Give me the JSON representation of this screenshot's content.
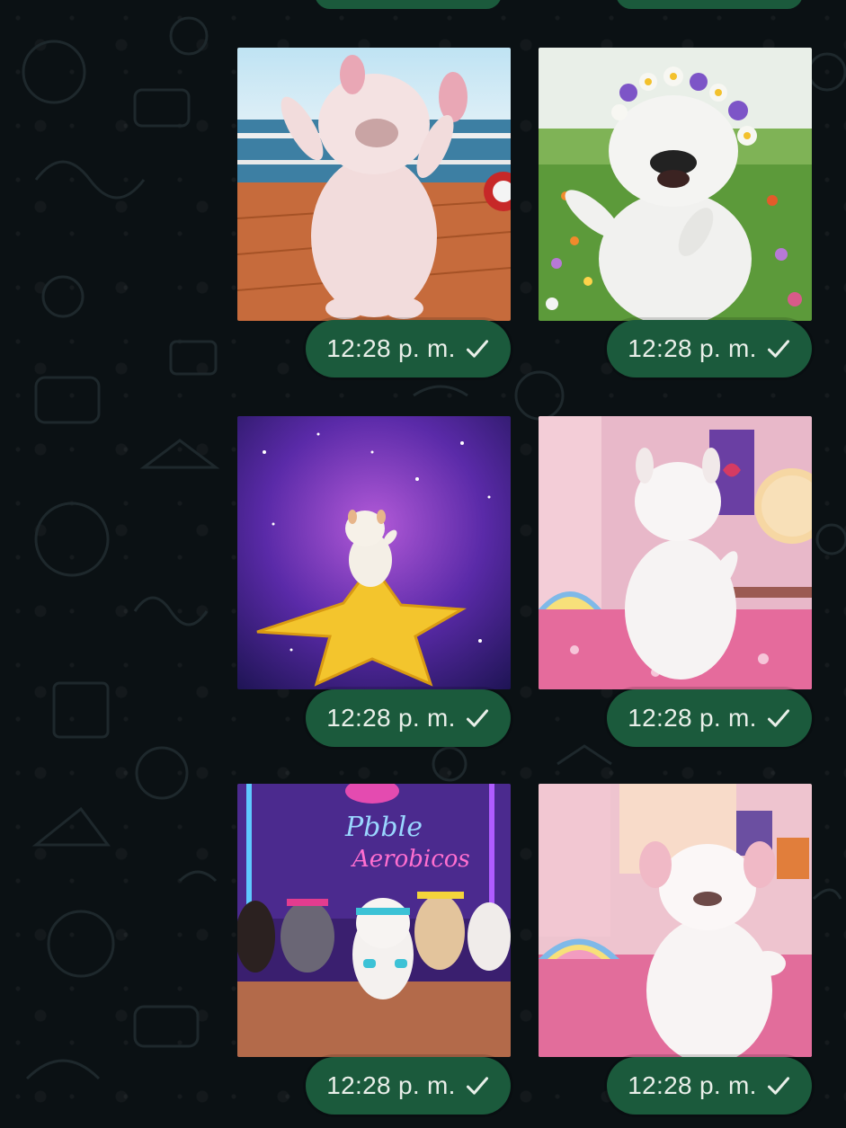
{
  "conversation": {
    "messages": [
      {
        "time": "12:28 p. m.",
        "status": "sent-check",
        "image": "puppy dancing on ship deck"
      },
      {
        "time": "12:28 p. m.",
        "status": "sent-check",
        "image": "puppy with flower crown in meadow"
      },
      {
        "time": "12:28 p. m.",
        "status": "sent-check",
        "image": "puppy dancing on star in galaxy"
      },
      {
        "time": "12:28 p. m.",
        "status": "sent-check",
        "image": "puppy dancing in pink bedroom (back view)"
      },
      {
        "time": "12:28 p. m.",
        "status": "sent-check",
        "image": "puppies doing aerobics under neon sign"
      },
      {
        "time": "12:28 p. m.",
        "status": "sent-check",
        "image": "puppy dancing on pink bed"
      }
    ],
    "neon_sign": [
      "Pbble",
      "Aerobicos"
    ]
  },
  "colors": {
    "chat_background": "#0b1114",
    "bubble_green": "#1b5a3c",
    "timestamp_text": "#e9efe9"
  },
  "icons": {
    "status": "check-icon"
  }
}
